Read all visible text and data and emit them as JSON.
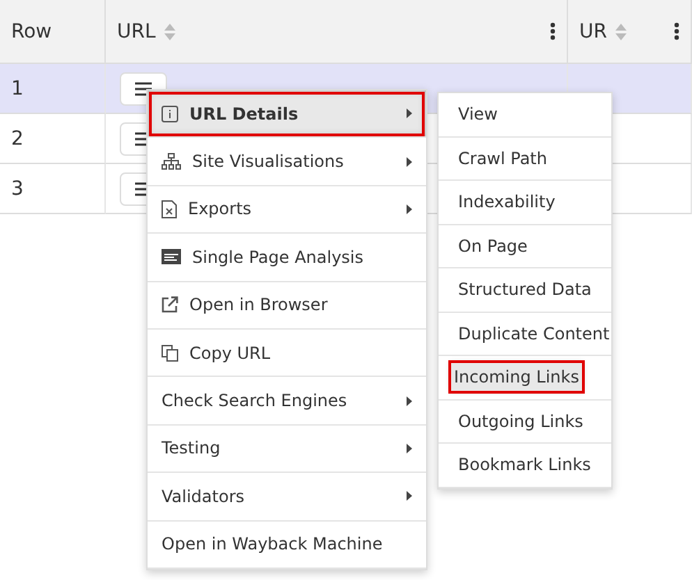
{
  "table": {
    "columns": [
      {
        "label": "Row",
        "sortable": false,
        "menu": false
      },
      {
        "label": "URL",
        "sortable": true,
        "menu": true
      },
      {
        "label": "UR",
        "sortable": true,
        "menu": true
      }
    ],
    "rows": [
      {
        "row": "1",
        "selected": true
      },
      {
        "row": "2",
        "selected": false
      },
      {
        "row": "3",
        "selected": false
      }
    ]
  },
  "context_menu": {
    "items": [
      {
        "label": "URL Details",
        "kind": "info",
        "submenu": true,
        "selected": true
      },
      {
        "label": "Site Visualisations",
        "kind": "sitemap",
        "submenu": true,
        "selected": false
      },
      {
        "label": "Exports",
        "kind": "file",
        "submenu": true,
        "selected": false
      },
      {
        "label": "Single Page Analysis",
        "kind": "analysis",
        "submenu": false,
        "selected": false
      },
      {
        "label": "Open in Browser",
        "kind": "external",
        "submenu": false,
        "selected": false
      },
      {
        "label": "Copy URL",
        "kind": "copy",
        "submenu": false,
        "selected": false
      },
      {
        "label": "Check Search Engines",
        "submenu": true,
        "selected": false
      },
      {
        "label": "Testing",
        "submenu": true,
        "selected": false
      },
      {
        "label": "Validators",
        "submenu": true,
        "selected": false
      },
      {
        "label": "Open in Wayback Machine",
        "submenu": false,
        "selected": false
      }
    ]
  },
  "submenu": {
    "items": [
      {
        "label": "View",
        "selected": false
      },
      {
        "label": "Crawl Path",
        "selected": false
      },
      {
        "label": "Indexability",
        "selected": false
      },
      {
        "label": "On Page",
        "selected": false
      },
      {
        "label": "Structured Data",
        "selected": false
      },
      {
        "label": "Duplicate Content",
        "selected": false
      },
      {
        "label": "Incoming Links",
        "selected": true
      },
      {
        "label": "Outgoing Links",
        "selected": false
      },
      {
        "label": "Bookmark Links",
        "selected": false
      }
    ]
  }
}
